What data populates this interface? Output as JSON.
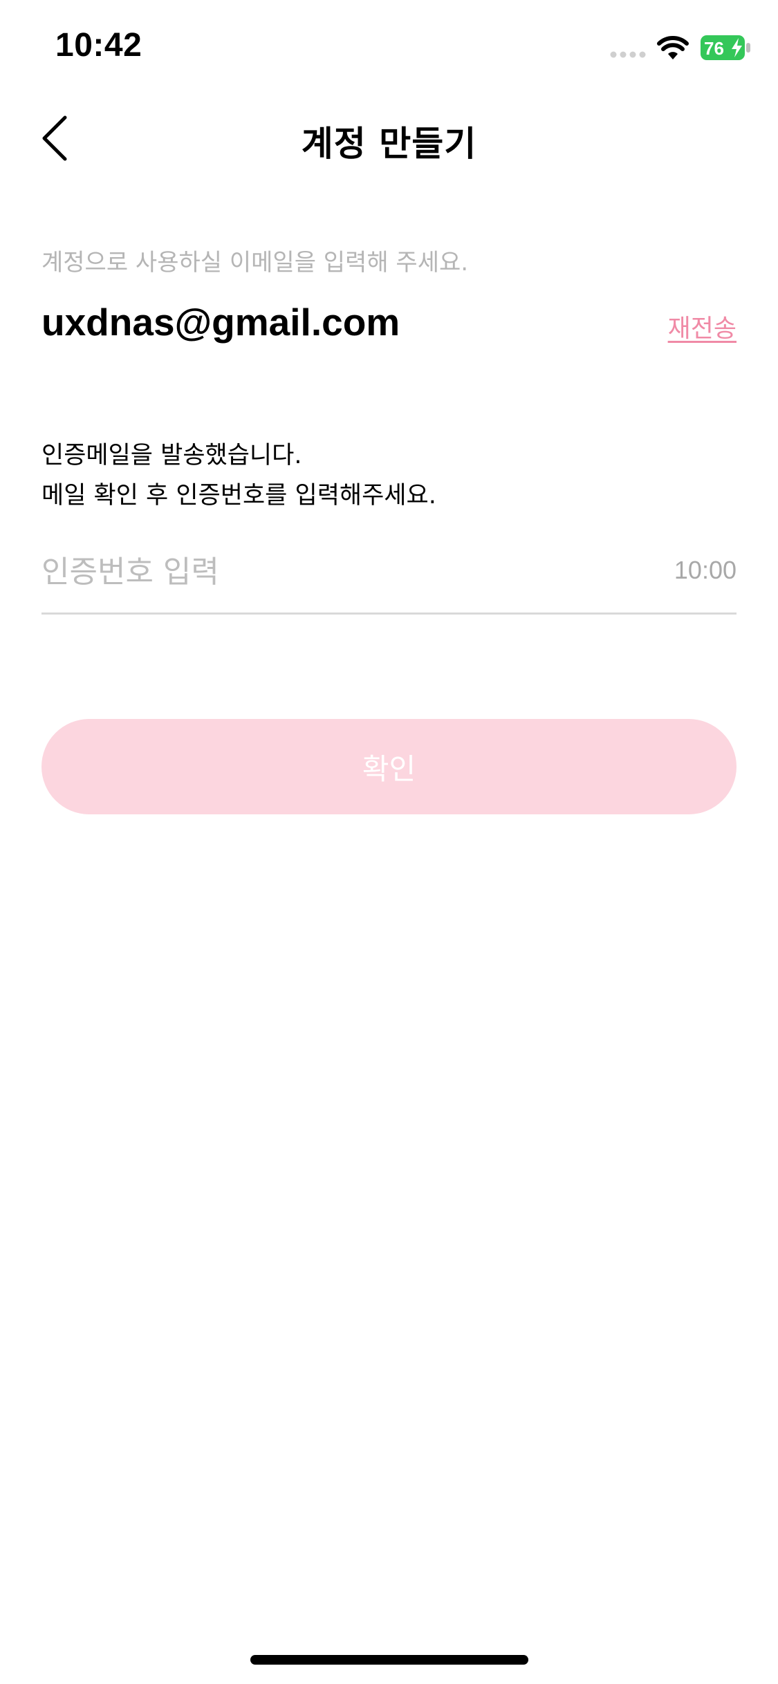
{
  "status_bar": {
    "time": "10:42",
    "battery_level": "76",
    "signal_icon": "signal-dots-icon",
    "wifi_icon": "wifi-icon",
    "battery_icon": "battery-charging-icon",
    "battery_color": "#34c759"
  },
  "nav": {
    "back_icon": "chevron-left-icon",
    "title": "계정 만들기"
  },
  "email_section": {
    "guide": "계정으로 사용하실 이메일을 입력해 주세요.",
    "email": "uxdnas@gmail.com",
    "resend_label": "재전송"
  },
  "verification": {
    "notice_line1": "인증메일을 발송했습니다.",
    "notice_line2": "메일 확인 후 인증번호를 입력해주세요.",
    "placeholder": "인증번호 입력",
    "value": "",
    "timer": "10:00"
  },
  "confirm_label": "확인",
  "colors": {
    "accent": "#f08aa6",
    "button_disabled": "#fcd6df"
  }
}
